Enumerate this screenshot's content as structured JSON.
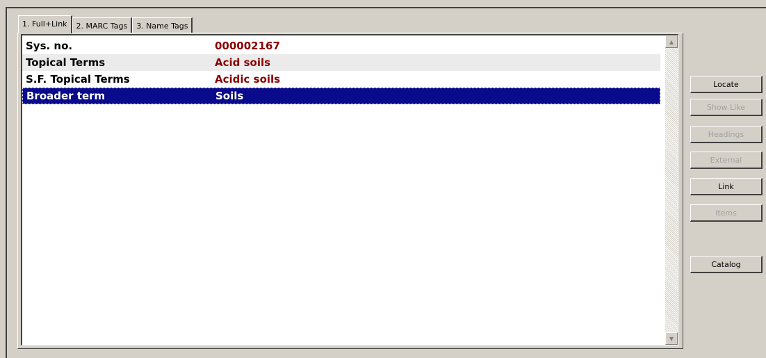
{
  "tabs": [
    {
      "label": "1. Full+Link"
    },
    {
      "label": "2. MARC Tags"
    },
    {
      "label": "3. Name Tags"
    }
  ],
  "rows": [
    {
      "label": "Sys. no.",
      "value": "000002167"
    },
    {
      "label": "Topical Terms",
      "value": "Acid soils"
    },
    {
      "label": "S.F. Topical Terms",
      "value": "Acidic soils"
    },
    {
      "label": "Broader term",
      "value": "Soils",
      "selected": true
    }
  ],
  "buttons": {
    "locate": "Locate",
    "show_like": "Show Like",
    "headings": "Headings",
    "external": "External",
    "link": "Link",
    "items": "Items",
    "catalog": "Catalog"
  },
  "scrollbar": {
    "up_icon": "arrow-up-icon",
    "down_icon": "arrow-down-icon"
  },
  "colors": {
    "selection": "#0a0a8c",
    "value_text": "#8b0000"
  }
}
